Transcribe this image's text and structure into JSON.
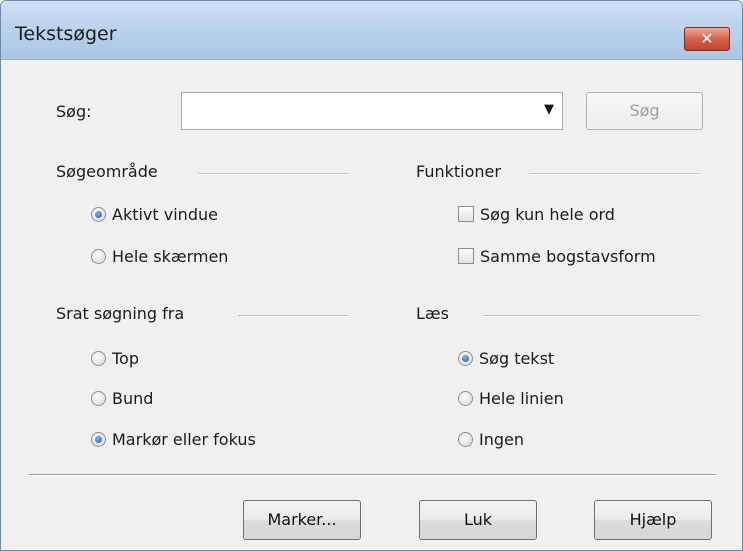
{
  "window": {
    "title": "Tekstsøger",
    "close_symbol": "✕"
  },
  "search": {
    "label": "Søg:",
    "value": "",
    "placeholder": "",
    "dropdown_symbol": "▼",
    "button_label": "Søg"
  },
  "search_area": {
    "heading": "Søgeområde",
    "options": [
      {
        "label": "Aktivt vindue",
        "checked": true
      },
      {
        "label": "Hele skærmen",
        "checked": false
      }
    ]
  },
  "functions": {
    "heading": "Funktioner",
    "options": [
      {
        "label": "Søg kun hele ord",
        "checked": false
      },
      {
        "label": "Samme bogstavsform",
        "checked": false
      }
    ]
  },
  "start_search": {
    "heading": "Srat søgning fra",
    "options": [
      {
        "label": "Top",
        "checked": false
      },
      {
        "label": "Bund",
        "checked": false
      },
      {
        "label": "Markør eller fokus",
        "checked": true
      }
    ]
  },
  "read": {
    "heading": "Læs",
    "options": [
      {
        "label": "Søg tekst",
        "checked": true
      },
      {
        "label": "Hele linien",
        "checked": false
      },
      {
        "label": "Ingen",
        "checked": false
      }
    ]
  },
  "buttons": {
    "mark": "Marker...",
    "close": "Luk",
    "help": "Hjælp"
  }
}
